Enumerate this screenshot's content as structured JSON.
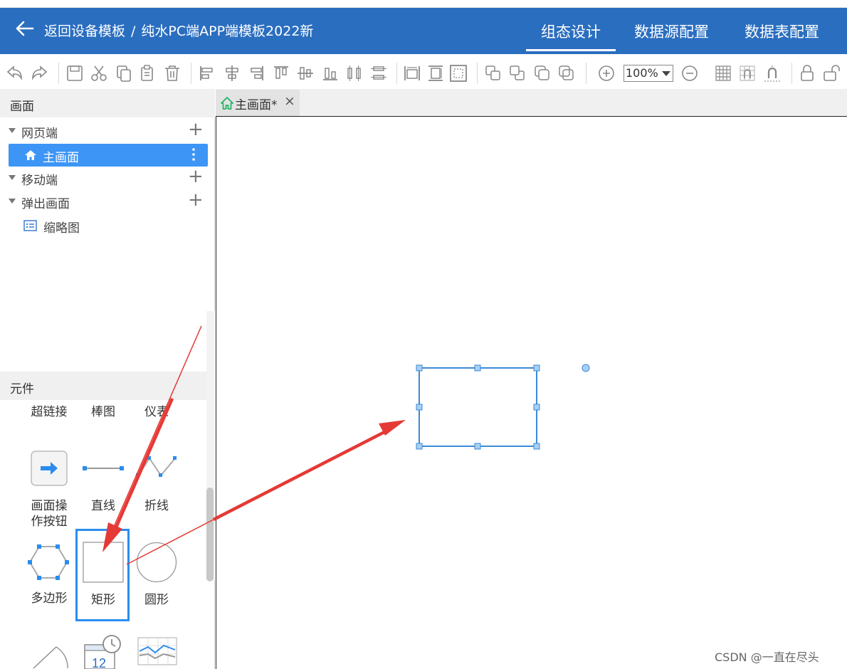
{
  "header": {
    "back_label": "返回设备模板",
    "separator": "/",
    "template_name": "纯水PC端APP端模板2022新",
    "tabs": [
      {
        "label": "组态设计",
        "active": true
      },
      {
        "label": "数据源配置",
        "active": false
      },
      {
        "label": "数据表配置",
        "active": false
      }
    ],
    "color": "#2a6ec0"
  },
  "toolbar": {
    "zoom": "100%",
    "icons": [
      "undo-icon",
      "redo-icon",
      "save-icon",
      "cut-icon",
      "copy-icon",
      "paste-icon",
      "delete-icon",
      "align-left-icon",
      "align-center-h-icon",
      "align-right-icon",
      "align-top-icon",
      "align-middle-icon",
      "align-bottom-icon",
      "distribute-h-icon",
      "distribute-v-icon",
      "same-width-icon",
      "same-height-icon",
      "same-size-icon",
      "bring-front-icon",
      "send-back-icon",
      "group-icon",
      "ungroup-icon",
      "zoom-in-icon",
      "zoom-out-icon",
      "grid-icon",
      "snap-grid-icon",
      "magnet-icon",
      "lock-icon",
      "unlock-icon"
    ]
  },
  "left_panel": {
    "screens_title": "画面",
    "tree": [
      {
        "label": "网页端",
        "type": "group"
      },
      {
        "label": "主画面",
        "type": "page",
        "selected": true
      },
      {
        "label": "移动端",
        "type": "group"
      },
      {
        "label": "弹出画面",
        "type": "group"
      },
      {
        "label": "缩略图",
        "type": "thumbnail"
      }
    ],
    "components_title": "元件",
    "components": [
      {
        "label": "超链接"
      },
      {
        "label": "棒图"
      },
      {
        "label": "仪表"
      },
      {
        "label": "画面操作按钮"
      },
      {
        "label": "直线"
      },
      {
        "label": "折线"
      },
      {
        "label": "多边形"
      },
      {
        "label": "矩形",
        "selected": true
      },
      {
        "label": "圆形"
      }
    ],
    "accent": "#3d95f5"
  },
  "canvas": {
    "tab_label": "主画面*",
    "close_glyph": "×"
  },
  "watermark": "CSDN @一直在尽头",
  "annotation_color": "#e53935"
}
